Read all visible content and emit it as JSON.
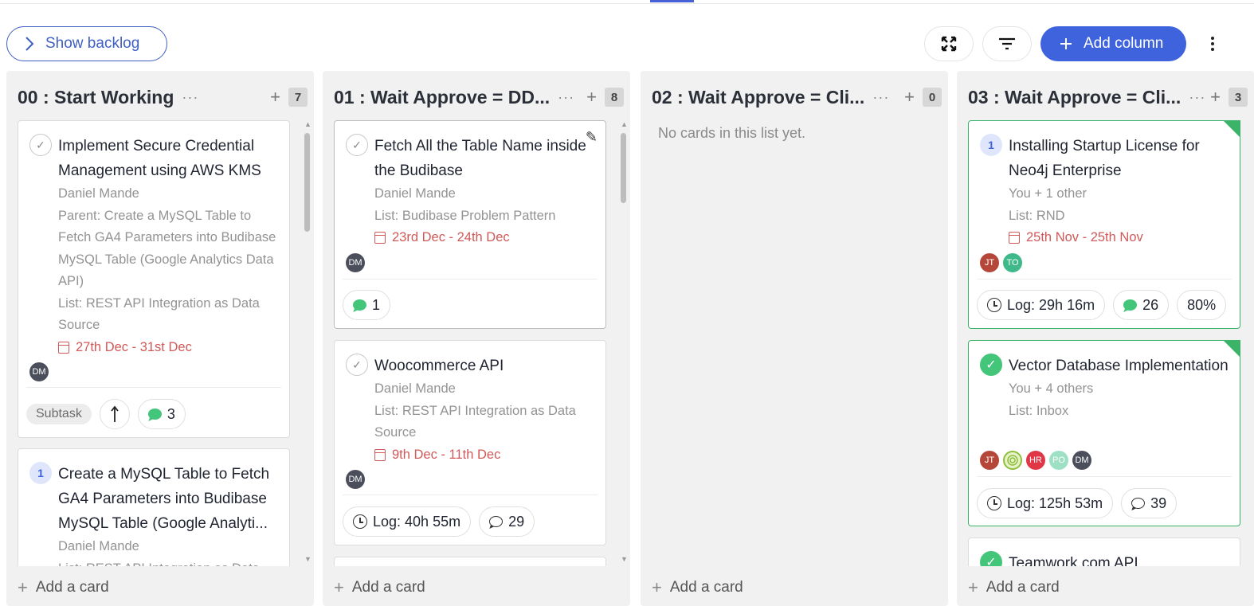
{
  "toolbar": {
    "backlog_label": "Show backlog",
    "add_column_label": "Add column"
  },
  "columns": [
    {
      "title": "00 : Start Working",
      "count": "7",
      "add_card": "Add a card",
      "cards": [
        {
          "title": "Implement Secure Credential Management using AWS KMS",
          "assignee": "Daniel Mande",
          "parent": "Parent: Create a MySQL Table to Fetch GA4 Parameters into Budibase MySQL Table (Google Analytics Data API)",
          "list": "List: REST API Integration as Data Source",
          "date": "27th Dec - 31st Dec",
          "avatar": "DM",
          "tag": "Subtask",
          "comments": "3"
        },
        {
          "badge": "1",
          "title": "Create a MySQL Table to Fetch GA4 Parameters into Budibase MySQL Table (Google Analyti...",
          "assignee": "Daniel Mande",
          "list": "List: REST API Integration as Data"
        }
      ]
    },
    {
      "title": "01 : Wait Approve = DD...",
      "count": "8",
      "add_card": "Add a card",
      "cards": [
        {
          "title": "Fetch All the Table Name inside the Budibase",
          "assignee": "Daniel Mande",
          "list": "List: Budibase Problem Pattern",
          "date": "23rd Dec - 24th Dec",
          "avatar": "DM",
          "comments": "1"
        },
        {
          "title": "Woocommerce API",
          "assignee": "Daniel Mande",
          "list": "List: REST API Integration as Data Source",
          "date": "9th Dec - 11th Dec",
          "avatar": "DM",
          "log": "Log: 40h 55m",
          "comments": "29"
        }
      ]
    },
    {
      "title": "02 : Wait Approve = Cli...",
      "count": "0",
      "empty": "No cards in this list yet.",
      "add_card": "Add a card"
    },
    {
      "title": "03 : Wait Approve = Cli...",
      "count": "3",
      "add_card": "Add a card",
      "cards": [
        {
          "badge": "1",
          "title": "Installing Startup License for Neo4j Enterprise",
          "assignee": "You + 1 other",
          "list": "List: RND",
          "date": "25th Nov - 25th Nov",
          "avatars": [
            "JT",
            "TO"
          ],
          "log": "Log: 29h 16m",
          "comments": "26",
          "progress": "80%"
        },
        {
          "title": "Vector Database Implementation",
          "assignee": "You + 4 others",
          "list": "List: Inbox",
          "avatars": [
            "JT",
            "",
            "HR",
            "PO",
            "DM"
          ],
          "log": "Log: 125h 53m",
          "comments": "39"
        },
        {
          "title": "Teamwork.com API"
        }
      ]
    }
  ],
  "colors": {
    "accent": "#3e63dd",
    "done_green": "#43c57a",
    "date_red": "#d15959"
  }
}
